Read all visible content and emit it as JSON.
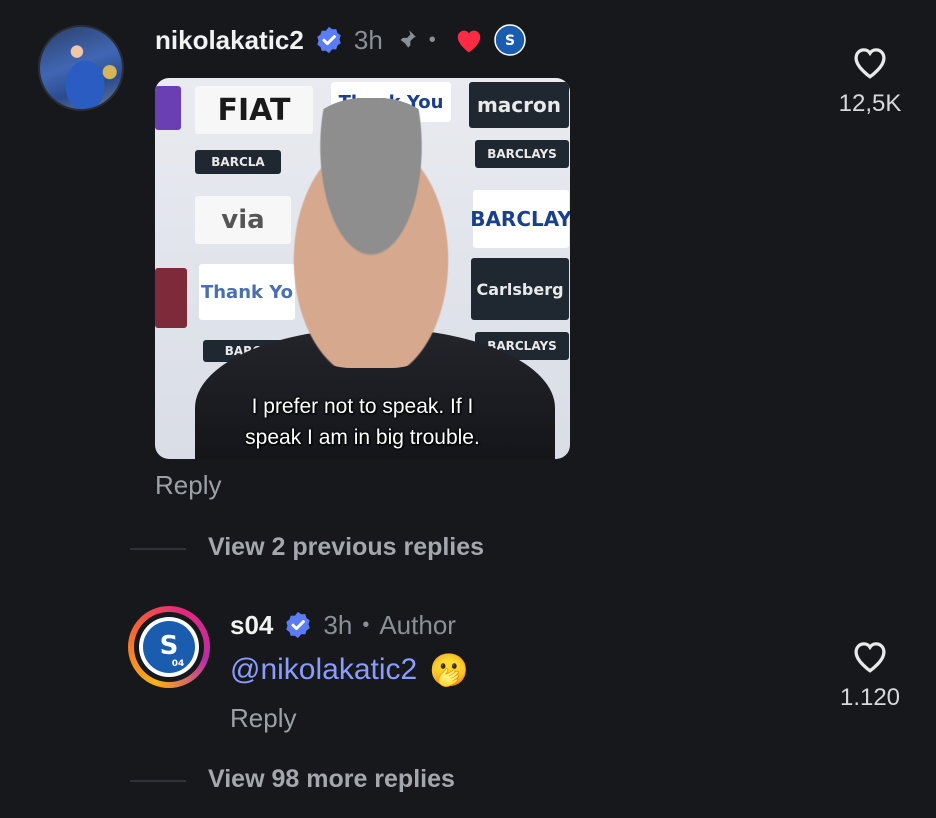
{
  "comment1": {
    "username": "nikolakatic2",
    "time": "3h",
    "separator": "•",
    "gif": {
      "boards": {
        "fiat": "FIAT",
        "thank_you_top": "Thank You",
        "macron": "macron",
        "barclays_left": "BARCLA",
        "barclays_right": "BARCLAYS",
        "via": "via",
        "barclays_blue": "BARCLAY",
        "thank_you": "Thank Yo",
        "carlsberg": "Carlsberg",
        "barclays_lower_left": "BARC",
        "barclays_lower_right": "BARCLAYS"
      },
      "caption_line1": "I prefer not to speak. If I",
      "caption_line2": "speak I am in big trouble."
    },
    "reply_label": "Reply",
    "like_count": "12,5K"
  },
  "thread1": {
    "label": "View 2 previous replies"
  },
  "comment2": {
    "username": "s04",
    "time": "3h",
    "separator": "•",
    "author_label": "Author",
    "mention": "@nikolakatic2",
    "emoji": "🫢",
    "reply_label": "Reply",
    "like_count": "1.120"
  },
  "thread2": {
    "label": "View 98 more replies"
  },
  "colors": {
    "background": "#16181c",
    "verified": "#5b7cf5",
    "heart": "#ff2b45",
    "mention": "#8b9cff",
    "schalke": "#1a5cad"
  },
  "icons": [
    "verified-icon",
    "pin-icon",
    "red-heart-icon",
    "schalke-badge-icon",
    "like-heart-icon"
  ]
}
